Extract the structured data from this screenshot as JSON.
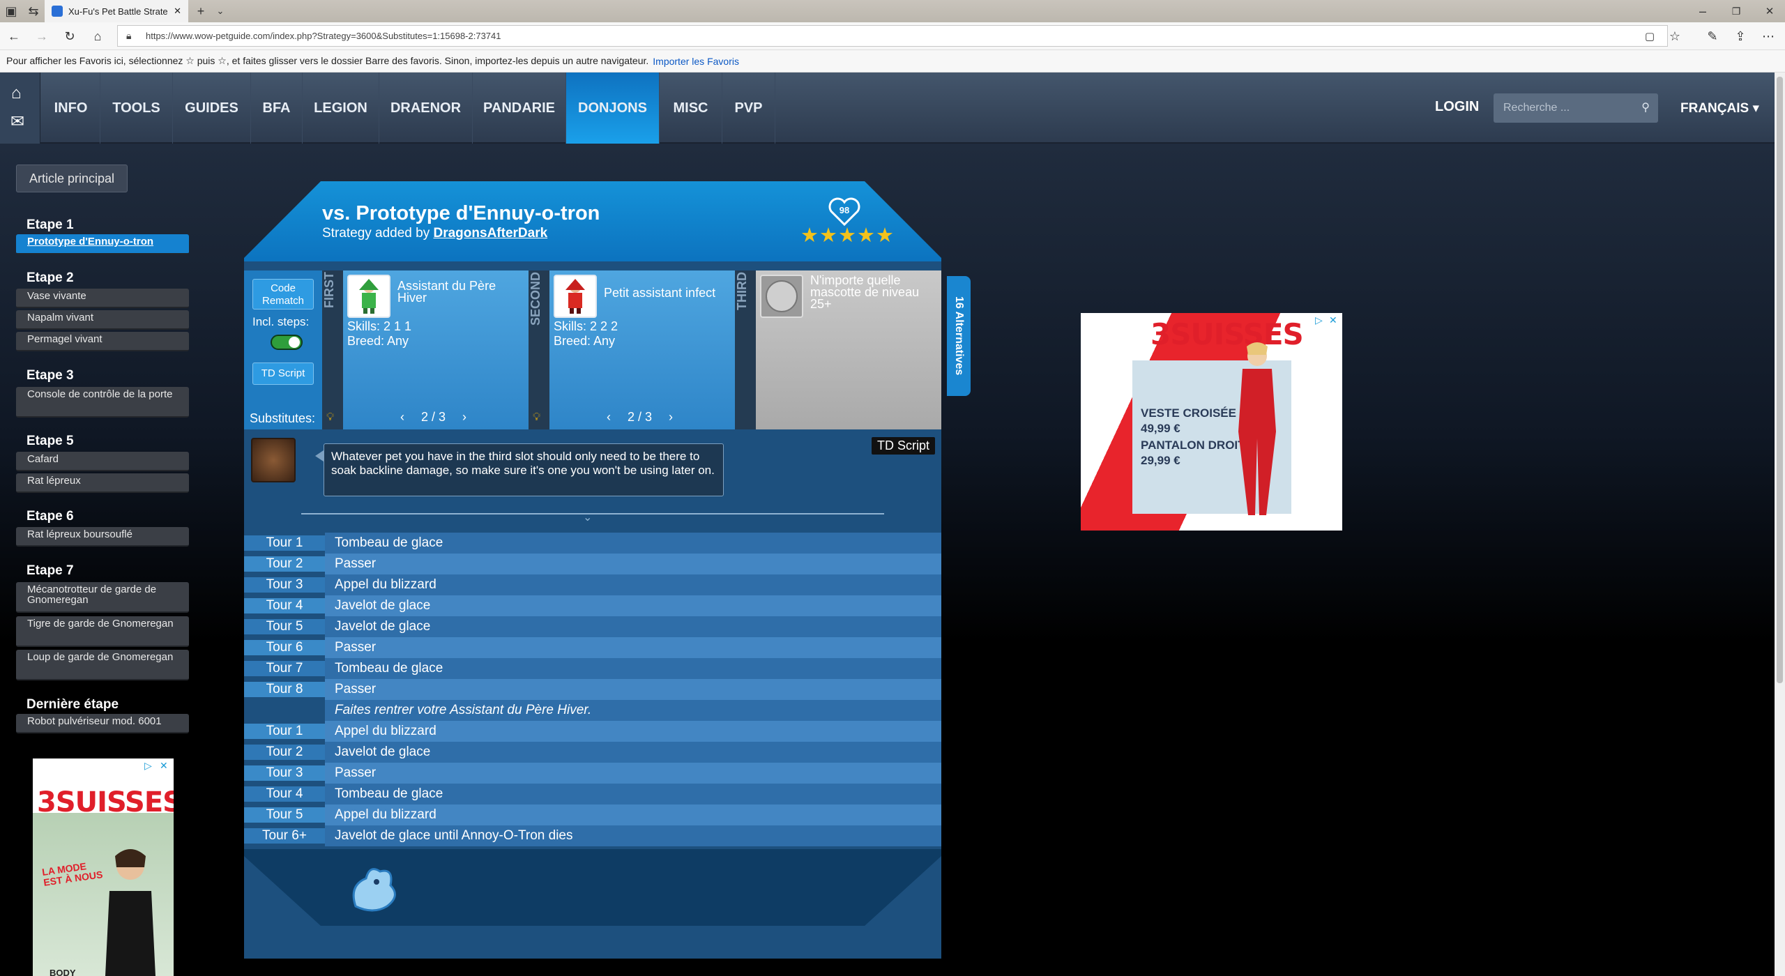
{
  "browser": {
    "tab_title": "Xu-Fu's Pet Battle Strate",
    "url": "https://www.wow-petguide.com/index.php?Strategy=3600&Substitutes=1:15698-2:73741",
    "favorites_bar_text": "Pour afficher les Favoris ici, sélectionnez ☆ puis ☆, et faites glisser vers le dossier Barre des favoris. Sinon, importez-les depuis un autre navigateur.",
    "favorites_link": "Importer les Favoris"
  },
  "nav": {
    "items": [
      "INFO",
      "TOOLS",
      "GUIDES",
      "BFA",
      "LEGION",
      "DRAENOR",
      "PANDARIE",
      "DONJONS",
      "MISC",
      "PVP"
    ],
    "active": "DONJONS",
    "login": "LOGIN",
    "search_placeholder": "Recherche ...",
    "language": "FRANÇAIS ▾"
  },
  "sidebar": {
    "article_button": "Article principal",
    "steps": [
      {
        "title": "Etape 1",
        "items": [
          "Prototype d'Ennuy-o-tron"
        ]
      },
      {
        "title": "Etape 2",
        "items": [
          "Vase vivante",
          "Napalm vivant",
          "Permagel vivant"
        ]
      },
      {
        "title": "Etape 3",
        "items": [
          "Console de contrôle de la porte"
        ]
      },
      {
        "title": "Etape 5",
        "items": [
          "Cafard",
          "Rat lépreux"
        ]
      },
      {
        "title": "Etape 6",
        "items": [
          "Rat lépreux boursouflé"
        ]
      },
      {
        "title": "Etape 7",
        "items": [
          "Mécanotrotteur de garde de Gnomeregan",
          "Tigre de garde de Gnomeregan",
          "Loup de garde de Gnomeregan"
        ]
      },
      {
        "title": "Dernière étape",
        "items": [
          "Robot pulvériseur mod. 6001"
        ]
      }
    ]
  },
  "strategy": {
    "title": "vs. Prototype d'Ennuy-o-tron",
    "added_by_prefix": "Strategy added by ",
    "author": "DragonsAfterDark",
    "likes": "98",
    "stars": "★★★★★",
    "code_rematch": "Code Rematch",
    "incl_steps": "Incl. steps:",
    "td_script": "TD Script",
    "substitutes_label": "Substitutes:",
    "alternatives": "16 Alternatives",
    "pets": [
      {
        "slot": "FIRST",
        "name": "Assistant du Père Hiver",
        "skills": "Skills: 2 1 1",
        "breed": "Breed: Any",
        "pager": "2 / 3"
      },
      {
        "slot": "SECOND",
        "name": "Petit assistant infect",
        "skills": "Skills: 2 2 2",
        "breed": "Breed: Any",
        "pager": "2 / 3"
      },
      {
        "slot": "THIRD",
        "name": "N'importe quelle mascotte de niveau 25+"
      }
    ],
    "tip": "Whatever pet you have in the third slot should only need to be there to soak backline damage, so make sure it's one you won't be using later on.",
    "td_badge": "TD Script",
    "turns": [
      {
        "turn": "Tour 1",
        "action": "Tombeau de glace"
      },
      {
        "turn": "Tour 2",
        "action": "Passer"
      },
      {
        "turn": "Tour 3",
        "action": "Appel du blizzard"
      },
      {
        "turn": "Tour 4",
        "action": "Javelot de glace"
      },
      {
        "turn": "Tour 5",
        "action": "Javelot de glace"
      },
      {
        "turn": "Tour 6",
        "action": "Passer"
      },
      {
        "turn": "Tour 7",
        "action": "Tombeau de glace"
      },
      {
        "turn": "Tour 8",
        "action": "Passer"
      },
      {
        "turn": "",
        "action": "Faites rentrer votre Assistant du Père Hiver."
      },
      {
        "turn": "Tour 1",
        "action": "Appel du blizzard"
      },
      {
        "turn": "Tour 2",
        "action": "Javelot de glace"
      },
      {
        "turn": "Tour 3",
        "action": "Passer"
      },
      {
        "turn": "Tour 4",
        "action": "Tombeau de glace"
      },
      {
        "turn": "Tour 5",
        "action": "Appel du blizzard"
      },
      {
        "turn": "Tour 6+",
        "action": "Javelot de glace until Annoy-O-Tron dies"
      }
    ]
  },
  "ads": {
    "brand": "3SUISSES",
    "ad1_lines": [
      "VESTE CROISÉE",
      "49,99 €",
      "PANTALON DROIT",
      "29,99 €"
    ],
    "ad2_lines": [
      "LA MODE",
      "EST À NOUS",
      "BODY"
    ]
  },
  "colors": {
    "accent": "#1582d0",
    "brand_red": "#e01f2a"
  }
}
